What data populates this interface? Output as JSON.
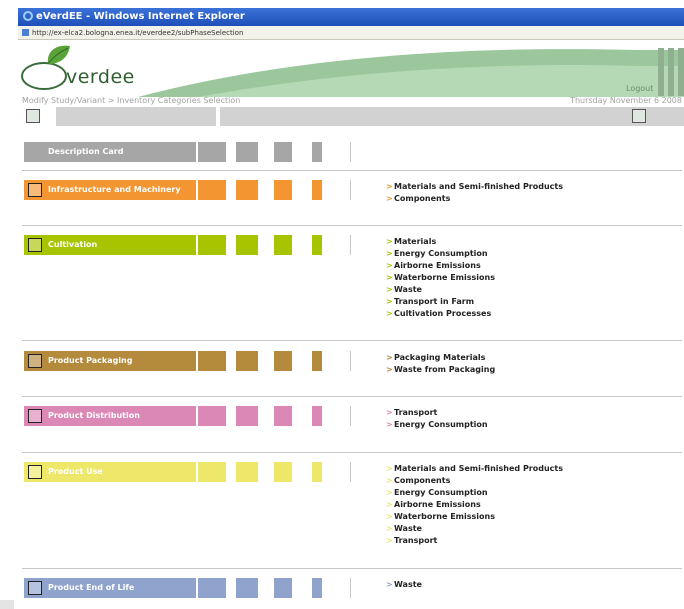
{
  "window": {
    "title": "eVerdEE - Windows Internet Explorer",
    "url": "http://ex-elca2.bologna.enea.it/everdee2/subPhaseSelection"
  },
  "header": {
    "logo_text": "verdee",
    "logout": "Logout"
  },
  "breadcrumb": "Modify Study/Variant > Inventory Categories Selection",
  "date": "Thursday November 6 2008",
  "colors": {
    "description": "#a6a6a6",
    "infrastructure": "#f39530",
    "cultivation": "#a8c400",
    "packaging": "#b48a3c",
    "distribution": "#dc88b6",
    "use": "#ede86a",
    "end_of_life": "#8fa3cc"
  },
  "description_card": "Description Card",
  "categories": [
    {
      "label": "Infrastructure and Machinery",
      "icon": "machinery-icon",
      "items": [
        "Materials and Semi-finished Products",
        "Components"
      ]
    },
    {
      "label": "Cultivation",
      "icon": "cultivation-icon",
      "items": [
        "Materials",
        "Energy Consumption",
        "Airborne Emissions",
        "Waterborne Emissions",
        "Waste",
        "Transport in Farm",
        "Cultivation Processes"
      ]
    },
    {
      "label": "Product Packaging",
      "icon": "packaging-icon",
      "items": [
        "Packaging Materials",
        "Waste from Packaging"
      ]
    },
    {
      "label": "Product Distribution",
      "icon": "truck-icon",
      "items": [
        "Transport",
        "Energy Consumption"
      ]
    },
    {
      "label": "Product Use",
      "icon": "product-use-icon",
      "items": [
        "Materials and Semi-finished Products",
        "Components",
        "Energy Consumption",
        "Airborne Emissions",
        "Waterborne Emissions",
        "Waste",
        "Transport"
      ]
    },
    {
      "label": "Product End of Life",
      "icon": "bin-icon",
      "items": [
        "Waste"
      ]
    }
  ]
}
